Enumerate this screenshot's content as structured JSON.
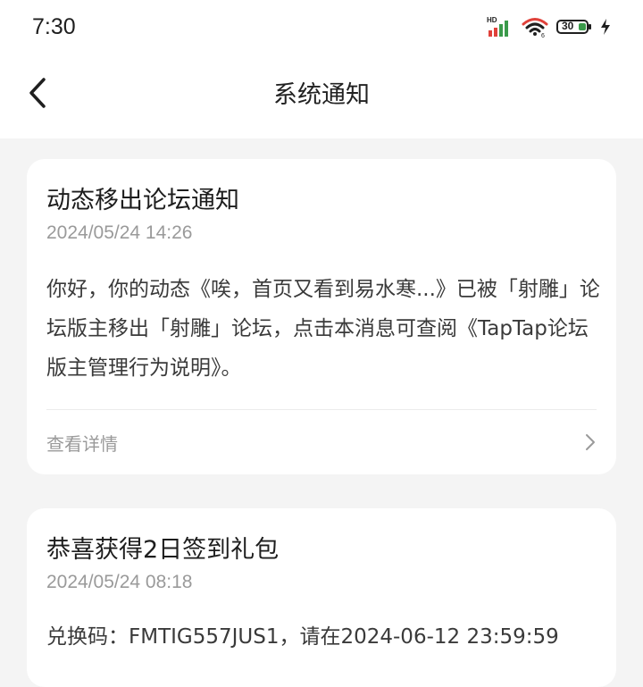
{
  "status_bar": {
    "time": "7:30",
    "battery": "30",
    "icons": [
      "hd-signal-icon",
      "wifi-icon",
      "battery-icon",
      "charging-icon"
    ]
  },
  "header": {
    "title": "系统通知",
    "back_icon": "back-chevron-icon"
  },
  "notifications": [
    {
      "title": "动态移出论坛通知",
      "time": "2024/05/24 14:26",
      "body": "你好，你的动态《唉，首页又看到易水寒...》已被「射雕」论坛版主移出「射雕」论坛，点击本消息可查阅《TapTap论坛版主管理行为说明》。",
      "detail_label": "查看详情"
    },
    {
      "title": "恭喜获得2日签到礼包",
      "time": "2024/05/24 08:18",
      "body": "兑换码：FMTIG557JUS1，请在2024-06-12 23:59:59"
    }
  ],
  "colors": {
    "page_background": "#f4f4f4",
    "card_background": "#ffffff",
    "secondary_text": "#9a9a9a",
    "signal_red": "#e0413a",
    "signal_green": "#3a9a4a"
  }
}
